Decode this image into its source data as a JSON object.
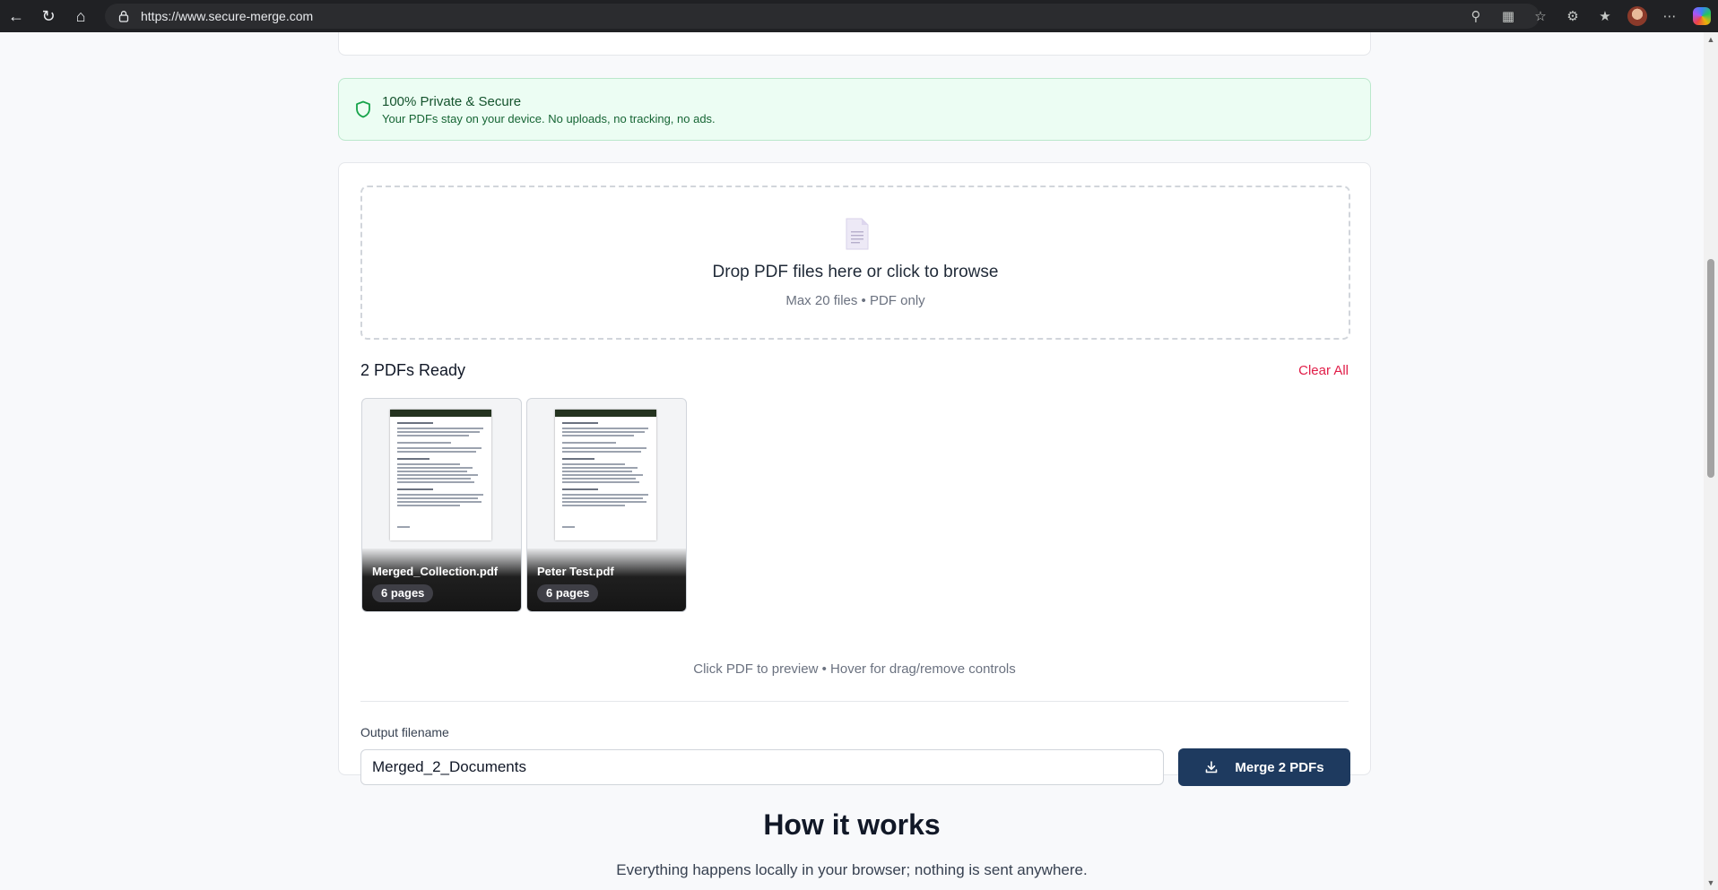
{
  "browser": {
    "url": "https://www.secure-merge.com"
  },
  "secure_banner": {
    "title": "100% Private & Secure",
    "subtitle": "Your PDFs stay on your device. No uploads, no tracking, no ads."
  },
  "dropzone": {
    "title": "Drop PDF files here or click to browse",
    "subtitle": "Max 20 files • PDF only"
  },
  "files": {
    "heading": "2 PDFs Ready",
    "clear_label": "Clear All",
    "items": [
      {
        "name": "Merged_Collection.pdf",
        "pages": "6 pages"
      },
      {
        "name": "Peter Test.pdf",
        "pages": "6 pages"
      }
    ],
    "hint": "Click PDF to preview • Hover for drag/remove controls"
  },
  "output": {
    "label": "Output filename",
    "value": "Merged_2_Documents",
    "merge_label": "Merge 2 PDFs"
  },
  "how_it_works": {
    "title": "How it works",
    "subtitle": "Everything happens locally in your browser; nothing is sent anywhere."
  },
  "colors": {
    "accent": "#1e3a5f",
    "danger": "#e11d48",
    "secure_bg": "#ecfdf3"
  }
}
